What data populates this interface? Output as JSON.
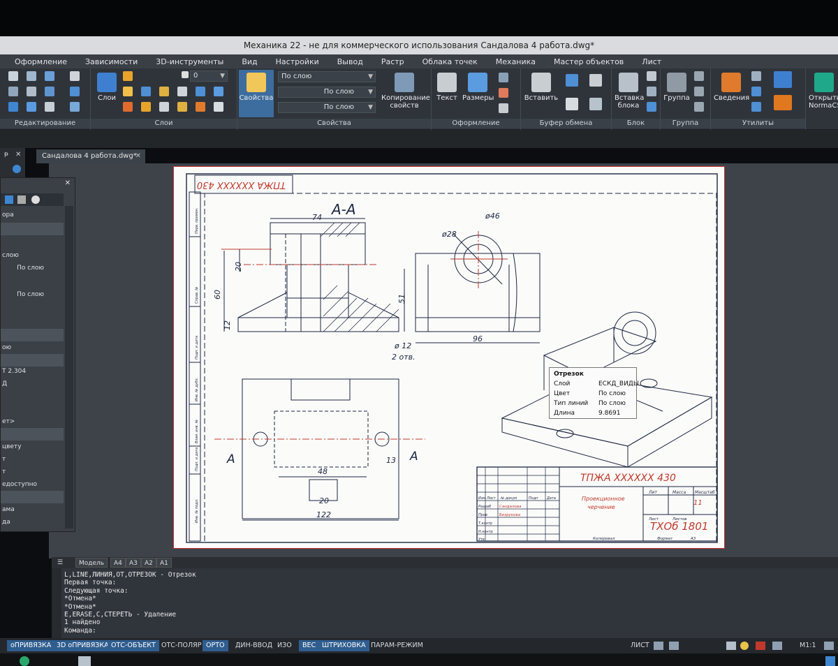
{
  "window": {
    "title": "Механика 22 - не для коммерческого использования Сандалова 4 работа.dwg*"
  },
  "menu": [
    "Оформление",
    "Зависимости",
    "3D-инструменты",
    "Вид",
    "Настройки",
    "Вывод",
    "Растр",
    "Облака точек",
    "Механика",
    "Мастер объектов",
    "Лист"
  ],
  "ribbon": {
    "groups": [
      "Редактирование",
      "Слои",
      "Свойства",
      "Оформление",
      "Буфер обмена",
      "Блок",
      "Группа",
      "Утилиты"
    ],
    "layers_btn": "Слои",
    "props_btn": "Свойства",
    "combo_layer": "По слою",
    "combo_line1": "По слою",
    "combo_line2": "По слою",
    "layer_value": "0",
    "copy_props": "Копирование свойств",
    "text_btn": "Текст",
    "dims_btn": "Размеры",
    "paste_btn": "Вставить",
    "insert_block": "Вставка блока",
    "group_btn": "Группа",
    "measure_btn": "Сведения",
    "open_btn": "Открыть NormaCS"
  },
  "doc_tab": "Сандалова 4 работа.dwg*",
  "props_panel": {
    "rows": [
      "ора",
      "",
      "слою",
      "По слою",
      "",
      "По слою",
      "",
      "",
      "ою",
      "",
      "Т 2.304",
      "Д",
      "",
      "ет>",
      "",
      "цвету",
      "т",
      "т",
      "едоступно",
      "",
      "ама",
      "да"
    ]
  },
  "drawing": {
    "stamp_top": "ТПЖА XXXXXX 430",
    "section_label": "А-А",
    "dims": {
      "d74": "74",
      "d20": "20",
      "d60": "60",
      "d12": "12",
      "phi28": "ø28",
      "phi46": "ø46",
      "d51": "51",
      "d96": "96",
      "phi12": "ø 12",
      "holes": "2 отв.",
      "d48": "48",
      "d13": "13",
      "d20b": "20",
      "d122": "122"
    },
    "cut_left": "А",
    "cut_right": "А",
    "title_block": {
      "code": "ТПЖА XXXXXX 430",
      "name_line1": "Проекционное",
      "name_line2": "черчение",
      "sheet_total": "11",
      "group": "ТХОб 1801",
      "cols": [
        "Лит",
        "Масса",
        "Масштаб"
      ],
      "copied": "Копировал",
      "format": "Формат",
      "format_val": "А3",
      "sheet": "Лист",
      "sheets": "Листов",
      "row_labels": [
        "Изм",
        "Лист",
        "№ докум",
        "Подп",
        "Дата",
        "Разраб",
        "Пров",
        "Т.контр",
        "Н.контр",
        "Утв"
      ],
      "names": [
        "Сандалова",
        "Безрукова"
      ]
    },
    "side_labels": [
      "Перв. примен.",
      "Справ. №",
      "Подп. и дата",
      "Инв. № дубл.",
      "Взам. инв. №",
      "Подп. и дата",
      "Инв. № подл."
    ]
  },
  "tooltip": {
    "title": "Отрезок",
    "rows": [
      {
        "k": "Слой",
        "v": "ЕСКД_ВИДЫ"
      },
      {
        "k": "Цвет",
        "v": "По слою"
      },
      {
        "k": "Тип линий",
        "v": "По слою"
      },
      {
        "k": "Длина",
        "v": "9.8691"
      }
    ]
  },
  "layout_tabs": [
    "Модель",
    "А4",
    "А3",
    "А2",
    "А1"
  ],
  "command_history": [
    "L,LINE,ЛИНИЯ,ОТ,ОТРЕЗОК - Отрезок",
    "Первая точка:",
    "Следующая точка:",
    "*Отмена*",
    "*Отмена*",
    "E,ERASE,С,СТЕРЕТЬ - Удаление",
    "1 найдено",
    "Команда:"
  ],
  "status": {
    "buttons": [
      {
        "label": "оПРИВЯЗКА",
        "on": true
      },
      {
        "label": "3D оПРИВЯЗКА",
        "on": true
      },
      {
        "label": "ОТС-ОБЪЕКТ",
        "on": true
      },
      {
        "label": "ОТС-ПОЛЯР",
        "on": false
      },
      {
        "label": "ОРТО",
        "on": true
      },
      {
        "label": "ДИН-ВВОД",
        "on": false
      },
      {
        "label": "ИЗО",
        "on": false
      },
      {
        "label": "ВЕС",
        "on": true
      },
      {
        "label": "ШТРИХОВКА",
        "on": true
      },
      {
        "label": "ПАРАМ-РЕЖИМ",
        "on": false
      }
    ],
    "space": "ЛИСТ",
    "scale": "M1:1"
  },
  "colors": {
    "accent": "#2f5d8f",
    "sheet_border": "#cc3333",
    "drawing_line": "#1b2640",
    "red_text": "#c0392b"
  }
}
